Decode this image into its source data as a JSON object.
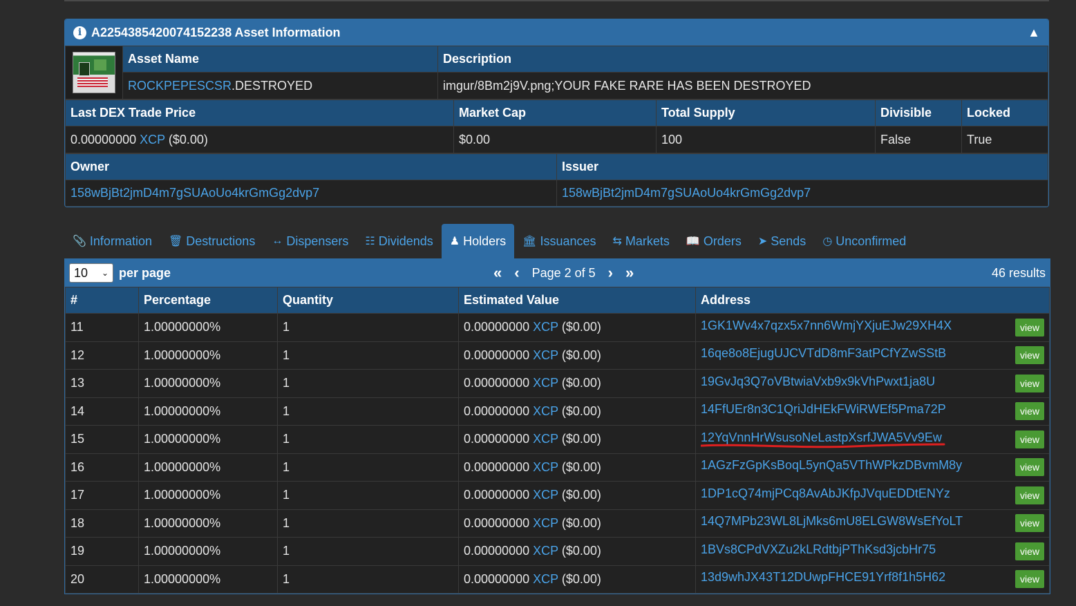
{
  "panel": {
    "title": "A2254385420074152238 Asset Information",
    "asset_name_header": "Asset Name",
    "description_header": "Description",
    "asset_name_link": "ROCKPEPESCSR",
    "asset_name_suffix": ".DESTROYED",
    "description": "imgur/8Bm2j9V.png;YOUR FAKE RARE HAS BEEN DESTROYED",
    "headers2": [
      "Last DEX Trade Price",
      "Market Cap",
      "Total Supply",
      "Divisible",
      "Locked"
    ],
    "last_price_amount": "0.00000000",
    "last_price_unit": "XCP",
    "last_price_usd": "($0.00)",
    "market_cap": "$0.00",
    "total_supply": "100",
    "divisible": "False",
    "locked": "True",
    "owner_header": "Owner",
    "issuer_header": "Issuer",
    "owner": "158wBjBt2jmD4m7gSUAoUo4krGmGg2dvp7",
    "issuer": "158wBjBt2jmD4m7gSUAoUo4krGmGg2dvp7"
  },
  "tabs": [
    {
      "label": "Information",
      "icon": "paperclip-icon"
    },
    {
      "label": "Destructions",
      "icon": "trash-icon"
    },
    {
      "label": "Dispensers",
      "icon": "arrows-h-icon"
    },
    {
      "label": "Dividends",
      "icon": "sitemap-icon"
    },
    {
      "label": "Holders",
      "icon": "user-icon"
    },
    {
      "label": "Issuances",
      "icon": "bank-icon"
    },
    {
      "label": "Markets",
      "icon": "exchange-icon"
    },
    {
      "label": "Orders",
      "icon": "book-icon"
    },
    {
      "label": "Sends",
      "icon": "send-icon"
    },
    {
      "label": "Unconfirmed",
      "icon": "clock-icon"
    }
  ],
  "pager": {
    "per_page_value": "10",
    "per_page_label": "per page",
    "page_label": "Page 2 of 5",
    "results": "46 results"
  },
  "table": {
    "headers": [
      "#",
      "Percentage",
      "Quantity",
      "Estimated Value",
      "Address"
    ],
    "view_label": "view",
    "rows": [
      {
        "n": "11",
        "pct": "1.00000000%",
        "qty": "1",
        "val": "0.00000000",
        "unit": "XCP",
        "usd": "($0.00)",
        "addr": "1GK1Wv4x7qzx5x7nn6WmjYXjuEJw29XH4X"
      },
      {
        "n": "12",
        "pct": "1.00000000%",
        "qty": "1",
        "val": "0.00000000",
        "unit": "XCP",
        "usd": "($0.00)",
        "addr": "16qe8o8EjugUJCVTdD8mF3atPCfYZwSStB"
      },
      {
        "n": "13",
        "pct": "1.00000000%",
        "qty": "1",
        "val": "0.00000000",
        "unit": "XCP",
        "usd": "($0.00)",
        "addr": "19GvJq3Q7oVBtwiaVxb9x9kVhPwxt1ja8U"
      },
      {
        "n": "14",
        "pct": "1.00000000%",
        "qty": "1",
        "val": "0.00000000",
        "unit": "XCP",
        "usd": "($0.00)",
        "addr": "14FfUEr8n3C1QriJdHEkFWiRWEf5Pma72P"
      },
      {
        "n": "15",
        "pct": "1.00000000%",
        "qty": "1",
        "val": "0.00000000",
        "unit": "XCP",
        "usd": "($0.00)",
        "addr": "12YqVnnHrWsusoNeLastpXsrfJWA5Vv9Ew"
      },
      {
        "n": "16",
        "pct": "1.00000000%",
        "qty": "1",
        "val": "0.00000000",
        "unit": "XCP",
        "usd": "($0.00)",
        "addr": "1AGzFzGpKsBoqL5ynQa5VThWPkzDBvmM8y"
      },
      {
        "n": "17",
        "pct": "1.00000000%",
        "qty": "1",
        "val": "0.00000000",
        "unit": "XCP",
        "usd": "($0.00)",
        "addr": "1DP1cQ74mjPCq8AvAbJKfpJVquEDDtENYz"
      },
      {
        "n": "18",
        "pct": "1.00000000%",
        "qty": "1",
        "val": "0.00000000",
        "unit": "XCP",
        "usd": "($0.00)",
        "addr": "14Q7MPb23WL8LjMks6mU8ELGW8WsEfYoLT"
      },
      {
        "n": "19",
        "pct": "1.00000000%",
        "qty": "1",
        "val": "0.00000000",
        "unit": "XCP",
        "usd": "($0.00)",
        "addr": "1BVs8CPdVXZu2kLRdtbjPThKsd3jcbHr75"
      },
      {
        "n": "20",
        "pct": "1.00000000%",
        "qty": "1",
        "val": "0.00000000",
        "unit": "XCP",
        "usd": "($0.00)",
        "addr": "13d9whJX43T12DUwpFHCE91Yrf8f1h5H62"
      }
    ]
  },
  "colors": {
    "accent": "#2e6ca4",
    "link": "#4aa3e8",
    "view_button": "#4a9a34",
    "background": "#2b2b2b",
    "annotation": "#e02020"
  }
}
